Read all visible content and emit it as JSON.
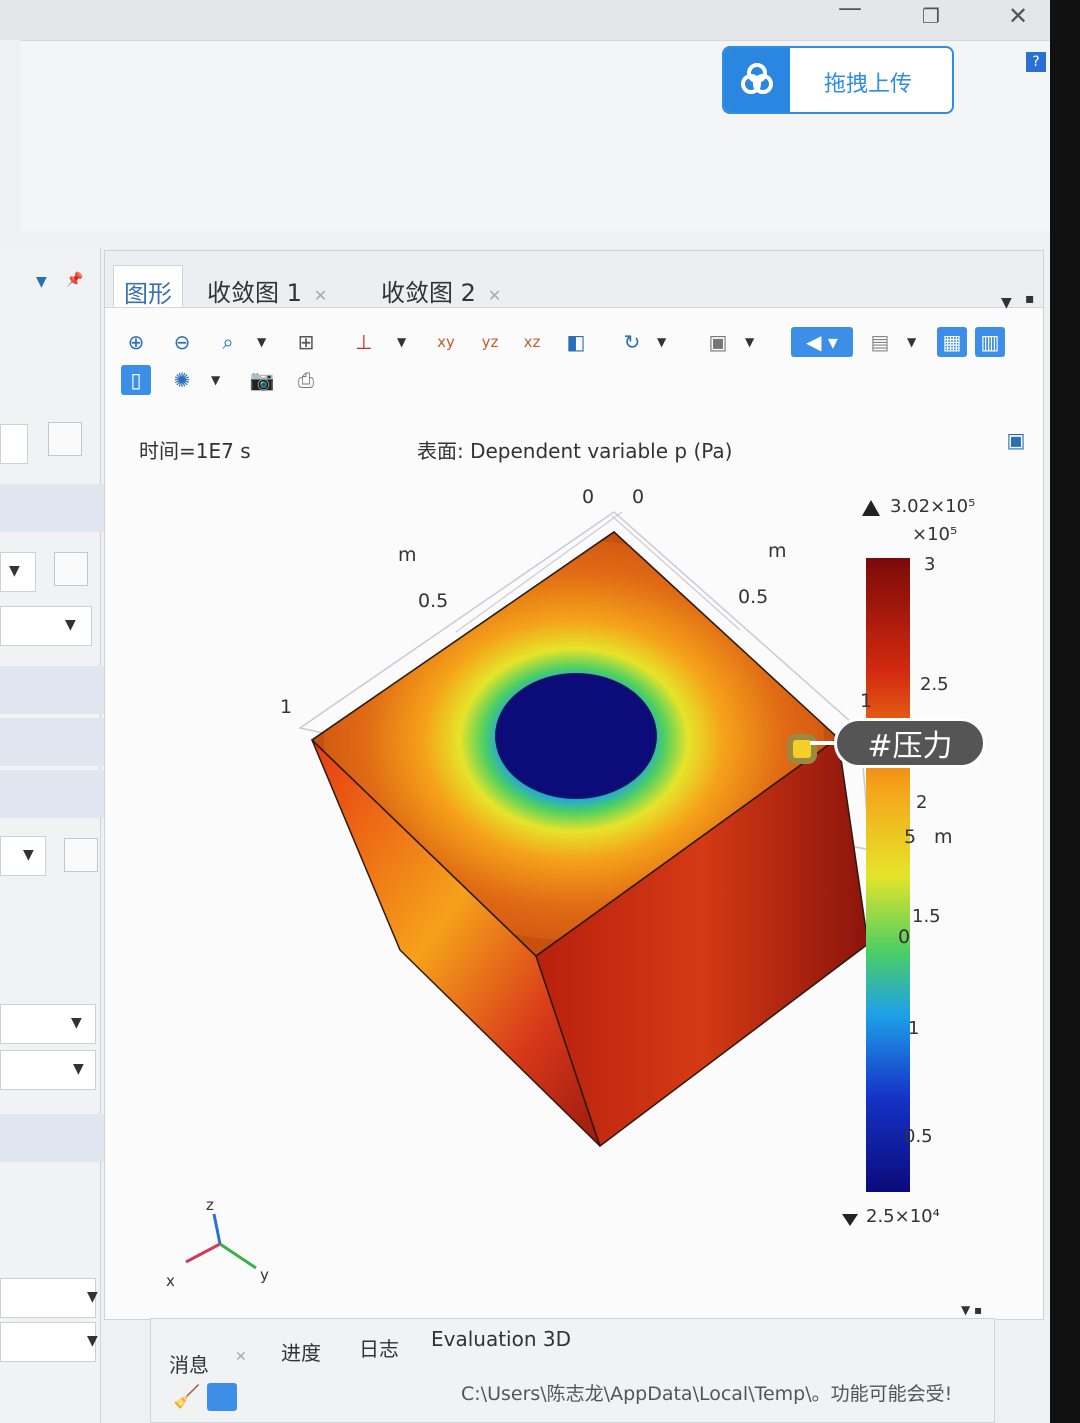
{
  "window": {
    "minimize": "—",
    "restore": "❐",
    "close": "✕"
  },
  "upload": {
    "label": "拖拽上传"
  },
  "help": {
    "label": "?"
  },
  "graphics_tabs": [
    {
      "label": "图形"
    },
    {
      "label": "收敛图 1"
    },
    {
      "label": "收敛图 2"
    }
  ],
  "plot": {
    "time_label": "时间=1E7 s",
    "surface_label": "表面: Dependent variable p (Pa)",
    "axis_labels": {
      "top_left_0": "0",
      "top_right_0": "0",
      "left_m": "m",
      "right_m": "m",
      "left_05": "0.5",
      "right_05": "0.5",
      "left_1": "1",
      "right_1": "1",
      "side_5": "5",
      "side_m": "m",
      "side_0": "0"
    },
    "triad": {
      "z": "z",
      "x": "x",
      "y": "y"
    }
  },
  "colorbar": {
    "max_label": "3.02×10⁵",
    "scale_label": "×10⁵",
    "ticks": [
      "3",
      "2.5",
      "2",
      "1.5",
      "1",
      "0.5"
    ],
    "min_label": "2.5×10⁴",
    "colors": [
      "#7a0a0a",
      "#d42a10",
      "#f5a21a",
      "#e6e42a",
      "#4ccf63",
      "#1fa0e8",
      "#1533c8",
      "#0b0b7a"
    ]
  },
  "annotation": {
    "label": "#压力"
  },
  "messages": {
    "tabs": [
      "消息",
      "进度",
      "日志",
      "Evaluation 3D"
    ],
    "path_text": "C:\\Users\\陈志龙\\AppData\\Local\\Temp\\。功能可能会受!"
  }
}
